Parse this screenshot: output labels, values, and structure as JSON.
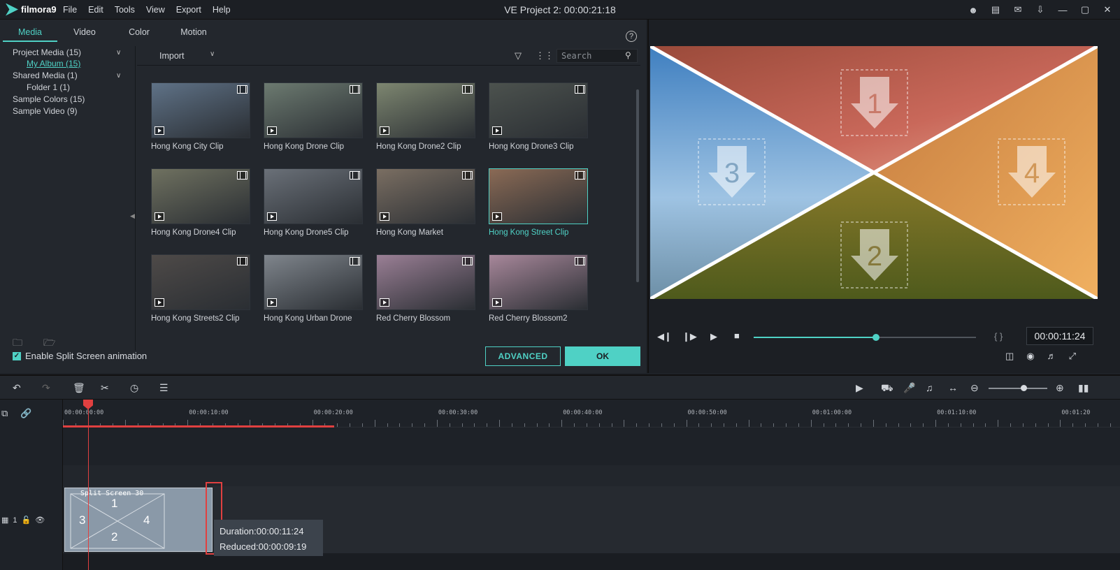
{
  "app": {
    "logo_text": "filmora9",
    "window_title": "VE Project 2: 00:00:21:18",
    "menu": [
      "File",
      "Edit",
      "Tools",
      "View",
      "Export",
      "Help"
    ]
  },
  "library": {
    "tabs": [
      "Media",
      "Video",
      "Color",
      "Motion"
    ],
    "active_tab": "Media",
    "tree": {
      "project_media": "Project Media (15)",
      "my_album": "My Album (15)",
      "shared_media": "Shared Media (1)",
      "folder1": "Folder 1 (1)",
      "sample_colors": "Sample Colors (15)",
      "sample_video": "Sample Video (9)"
    },
    "import_label": "Import",
    "search_placeholder": "Search",
    "clips": [
      {
        "label": "Hong Kong City Clip",
        "color": "#5f7287"
      },
      {
        "label": "Hong Kong Drone Clip",
        "color": "#6c7a70"
      },
      {
        "label": "Hong Kong Drone2 Clip",
        "color": "#7d8670"
      },
      {
        "label": "Hong Kong Drone3 Clip",
        "color": "#4c524e"
      },
      {
        "label": "Hong Kong Drone4 Clip",
        "color": "#6f7160"
      },
      {
        "label": "Hong Kong Drone5 Clip",
        "color": "#6a7078"
      },
      {
        "label": "Hong Kong Market",
        "color": "#7a6e62"
      },
      {
        "label": "Hong Kong Street Clip",
        "color": "#8a6a55"
      },
      {
        "label": "Hong Kong Streets2 Clip",
        "color": "#4e4a48"
      },
      {
        "label": "Hong Kong Urban Drone",
        "color": "#7f858c"
      },
      {
        "label": "Red Cherry Blossom",
        "color": "#9a7f95"
      },
      {
        "label": "Red Cherry Blossom2",
        "color": "#a7879a"
      }
    ],
    "selected_clip_index": 7,
    "split_screen_checkbox": "Enable Split Screen animation",
    "advanced_button": "ADVANCED",
    "ok_button": "OK"
  },
  "preview": {
    "quadrants": [
      "1",
      "2",
      "3",
      "4"
    ],
    "timecode": "00:00:11:24",
    "brackets": "{ }",
    "progress_fraction": 0.55
  },
  "timeline": {
    "ruler": [
      "00:00:00:00",
      "00:00:10:00",
      "00:00:20:00",
      "00:00:30:00",
      "00:00:40:00",
      "00:00:50:00",
      "00:01:00:00",
      "00:01:10:00",
      "00:01:20"
    ],
    "track_number": "1",
    "split_clip_title": "Split Screen 30",
    "split_clip_numbers": [
      "1",
      "3",
      "4",
      "2"
    ],
    "tooltip_duration": "Duration:00:00:11:24",
    "tooltip_reduced": "Reduced:00:00:09:19"
  }
}
